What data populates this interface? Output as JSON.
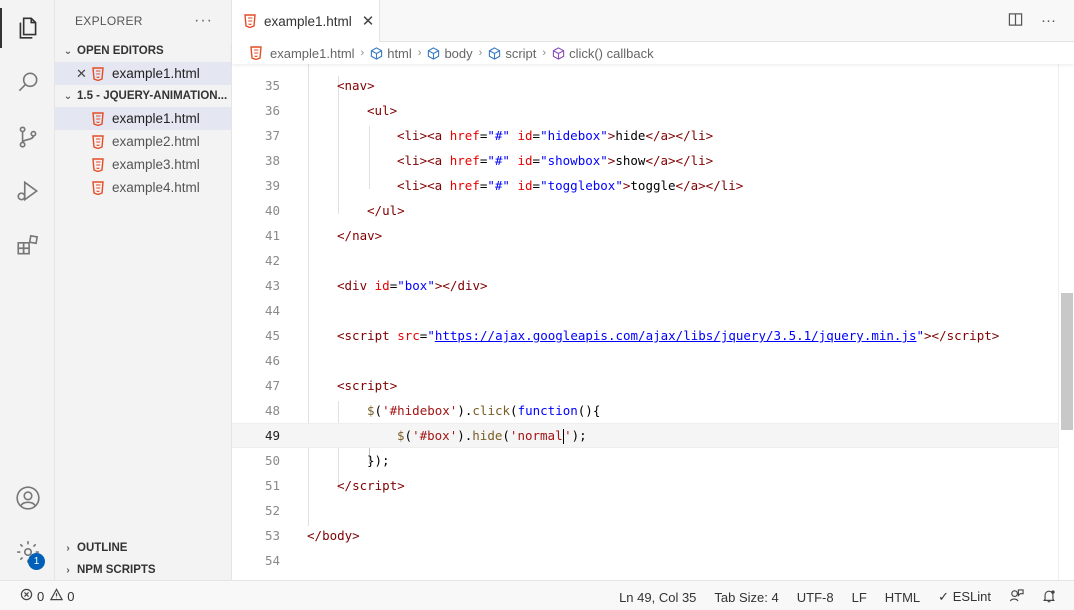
{
  "explorer": {
    "title": "EXPLORER",
    "more": "···",
    "open_editors": {
      "label": "OPEN EDITORS",
      "items": [
        {
          "name": "example1.html"
        }
      ]
    },
    "folder": {
      "label": "1.5 - JQUERY-ANIMATION...",
      "files": [
        {
          "name": "example1.html"
        },
        {
          "name": "example2.html"
        },
        {
          "name": "example3.html"
        },
        {
          "name": "example4.html"
        }
      ]
    },
    "outline_label": "OUTLINE",
    "npm_label": "NPM SCRIPTS"
  },
  "tab": {
    "label": "example1.html",
    "close": "✕"
  },
  "breadcrumb": {
    "file": "example1.html",
    "items": [
      "html",
      "body",
      "script",
      "click() callback"
    ]
  },
  "editor": {
    "lines": [
      {
        "n": "35",
        "tokens": [
          [
            "t-punc",
            "<"
          ],
          [
            "t-tag",
            "nav"
          ],
          [
            "t-punc",
            ">"
          ]
        ]
      },
      {
        "n": "36",
        "tokens": [
          [
            "t-punc",
            "<"
          ],
          [
            "t-tag",
            "ul"
          ],
          [
            "t-punc",
            ">"
          ]
        ]
      },
      {
        "n": "37",
        "tokens": [
          [
            "t-punc",
            "<"
          ],
          [
            "t-tag",
            "li"
          ],
          [
            "t-punc",
            "><"
          ],
          [
            "t-tag",
            "a "
          ],
          [
            "t-attr",
            "href"
          ],
          [
            "t-txt",
            "="
          ],
          [
            "t-str",
            "\"#\""
          ],
          [
            "t-txt",
            " "
          ],
          [
            "t-attr",
            "id"
          ],
          [
            "t-txt",
            "="
          ],
          [
            "t-str",
            "\"hidebox\""
          ],
          [
            "t-punc",
            ">"
          ],
          [
            "t-txt",
            "hide"
          ],
          [
            "t-punc",
            "</"
          ],
          [
            "t-tag",
            "a"
          ],
          [
            "t-punc",
            "></"
          ],
          [
            "t-tag",
            "li"
          ],
          [
            "t-punc",
            ">"
          ]
        ]
      },
      {
        "n": "38",
        "tokens": [
          [
            "t-punc",
            "<"
          ],
          [
            "t-tag",
            "li"
          ],
          [
            "t-punc",
            "><"
          ],
          [
            "t-tag",
            "a "
          ],
          [
            "t-attr",
            "href"
          ],
          [
            "t-txt",
            "="
          ],
          [
            "t-str",
            "\"#\""
          ],
          [
            "t-txt",
            " "
          ],
          [
            "t-attr",
            "id"
          ],
          [
            "t-txt",
            "="
          ],
          [
            "t-str",
            "\"showbox\""
          ],
          [
            "t-punc",
            ">"
          ],
          [
            "t-txt",
            "show"
          ],
          [
            "t-punc",
            "</"
          ],
          [
            "t-tag",
            "a"
          ],
          [
            "t-punc",
            "></"
          ],
          [
            "t-tag",
            "li"
          ],
          [
            "t-punc",
            ">"
          ]
        ]
      },
      {
        "n": "39",
        "tokens": [
          [
            "t-punc",
            "<"
          ],
          [
            "t-tag",
            "li"
          ],
          [
            "t-punc",
            "><"
          ],
          [
            "t-tag",
            "a "
          ],
          [
            "t-attr",
            "href"
          ],
          [
            "t-txt",
            "="
          ],
          [
            "t-str",
            "\"#\""
          ],
          [
            "t-txt",
            " "
          ],
          [
            "t-attr",
            "id"
          ],
          [
            "t-txt",
            "="
          ],
          [
            "t-str",
            "\"togglebox\""
          ],
          [
            "t-punc",
            ">"
          ],
          [
            "t-txt",
            "toggle"
          ],
          [
            "t-punc",
            "</"
          ],
          [
            "t-tag",
            "a"
          ],
          [
            "t-punc",
            "></"
          ],
          [
            "t-tag",
            "li"
          ],
          [
            "t-punc",
            ">"
          ]
        ]
      },
      {
        "n": "40",
        "tokens": [
          [
            "t-punc",
            "</"
          ],
          [
            "t-tag",
            "ul"
          ],
          [
            "t-punc",
            ">"
          ]
        ]
      },
      {
        "n": "41",
        "tokens": [
          [
            "t-punc",
            "</"
          ],
          [
            "t-tag",
            "nav"
          ],
          [
            "t-punc",
            ">"
          ]
        ]
      },
      {
        "n": "42",
        "tokens": []
      },
      {
        "n": "43",
        "tokens": [
          [
            "t-punc",
            "<"
          ],
          [
            "t-tag",
            "div "
          ],
          [
            "t-attr",
            "id"
          ],
          [
            "t-txt",
            "="
          ],
          [
            "t-str",
            "\"box\""
          ],
          [
            "t-punc",
            "></"
          ],
          [
            "t-tag",
            "div"
          ],
          [
            "t-punc",
            ">"
          ]
        ]
      },
      {
        "n": "44",
        "tokens": []
      },
      {
        "n": "45",
        "tokens": [
          [
            "t-punc",
            "<"
          ],
          [
            "t-tag",
            "script "
          ],
          [
            "t-attr",
            "src"
          ],
          [
            "t-txt",
            "="
          ],
          [
            "t-str",
            "\""
          ],
          [
            "t-url",
            "https://ajax.googleapis.com/ajax/libs/jquery/3.5.1/jquery.min.js"
          ],
          [
            "t-str",
            "\""
          ],
          [
            "t-punc",
            "></"
          ],
          [
            "t-tag",
            "script"
          ],
          [
            "t-punc",
            ">"
          ]
        ]
      },
      {
        "n": "46",
        "tokens": []
      },
      {
        "n": "47",
        "tokens": [
          [
            "t-punc",
            "<"
          ],
          [
            "t-tag",
            "script"
          ],
          [
            "t-punc",
            ">"
          ]
        ]
      },
      {
        "n": "48",
        "tokens": [
          [
            "t-fn",
            "$"
          ],
          [
            "t-js",
            "("
          ],
          [
            "t-jsstr",
            "'#hidebox'"
          ],
          [
            "t-js",
            ")."
          ],
          [
            "t-fn",
            "click"
          ],
          [
            "t-js",
            "("
          ],
          [
            "t-str",
            "function"
          ],
          [
            "t-js",
            "(){"
          ]
        ]
      },
      {
        "n": "49",
        "tokens": [
          [
            "t-fn",
            "$"
          ],
          [
            "t-js",
            "("
          ],
          [
            "t-jsstr",
            "'#box'"
          ],
          [
            "t-js",
            ")."
          ],
          [
            "t-fn",
            "hide"
          ],
          [
            "t-js",
            "("
          ],
          [
            "t-jsstr",
            "'normal"
          ],
          [
            "t-cursor",
            ""
          ],
          [
            "t-jsstr",
            "'"
          ],
          [
            "t-js",
            ");"
          ]
        ]
      },
      {
        "n": "50",
        "tokens": [
          [
            "t-js",
            "});"
          ]
        ]
      },
      {
        "n": "51",
        "tokens": [
          [
            "t-punc",
            "</"
          ],
          [
            "t-tag",
            "script"
          ],
          [
            "t-punc",
            ">"
          ]
        ]
      },
      {
        "n": "52",
        "tokens": []
      },
      {
        "n": "53",
        "tokens": [
          [
            "t-punc",
            "</"
          ],
          [
            "t-tag",
            "body"
          ],
          [
            "t-punc",
            ">"
          ]
        ]
      },
      {
        "n": "54",
        "tokens": []
      }
    ]
  },
  "status": {
    "errors": "0",
    "warnings": "0",
    "position": "Ln 49, Col 35",
    "tab_size": "Tab Size: 4",
    "encoding": "UTF-8",
    "eol": "LF",
    "language": "HTML",
    "linter": "ESLint"
  },
  "activity": {
    "notifications": "1"
  },
  "colors": {
    "accent": "#005fb8",
    "html_icon": "#e44d26",
    "cube_icon": "#3b7cc4"
  }
}
